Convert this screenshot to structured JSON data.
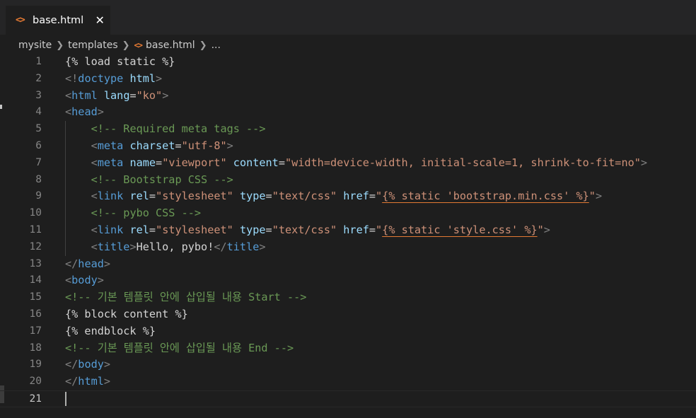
{
  "tab": {
    "icon": "html-code-icon",
    "label": "base.html",
    "close": "✕"
  },
  "breadcrumb": [
    {
      "label": "mysite"
    },
    {
      "label": "templates"
    },
    {
      "label": "base.html",
      "icon": "html-code-icon"
    },
    {
      "label": "..."
    }
  ],
  "editor": {
    "active_line": 21,
    "lines": [
      {
        "n": "1",
        "tokens": [
          [
            "{% load static %}",
            "d"
          ]
        ]
      },
      {
        "n": "2",
        "tokens": [
          [
            "<!",
            "br"
          ],
          [
            "doctype",
            "tag"
          ],
          [
            " ",
            "d"
          ],
          [
            "html",
            "attr"
          ],
          [
            ">",
            "br"
          ]
        ]
      },
      {
        "n": "3",
        "tokens": [
          [
            "<",
            "br"
          ],
          [
            "html",
            "tag"
          ],
          [
            " ",
            "d"
          ],
          [
            "lang",
            "attr"
          ],
          [
            "=",
            "d"
          ],
          [
            "\"ko\"",
            "str"
          ],
          [
            ">",
            "br"
          ]
        ]
      },
      {
        "n": "4",
        "tokens": [
          [
            "<",
            "br"
          ],
          [
            "head",
            "tag"
          ],
          [
            ">",
            "br"
          ]
        ]
      },
      {
        "n": "5",
        "tokens": [
          [
            "    ",
            "d"
          ],
          [
            "<!-- Required meta tags -->",
            "com"
          ]
        ]
      },
      {
        "n": "6",
        "tokens": [
          [
            "    ",
            "d"
          ],
          [
            "<",
            "br"
          ],
          [
            "meta",
            "tag"
          ],
          [
            " ",
            "d"
          ],
          [
            "charset",
            "attr"
          ],
          [
            "=",
            "d"
          ],
          [
            "\"utf-8\"",
            "str"
          ],
          [
            ">",
            "br"
          ]
        ]
      },
      {
        "n": "7",
        "tokens": [
          [
            "    ",
            "d"
          ],
          [
            "<",
            "br"
          ],
          [
            "meta",
            "tag"
          ],
          [
            " ",
            "d"
          ],
          [
            "name",
            "attr"
          ],
          [
            "=",
            "d"
          ],
          [
            "\"viewport\"",
            "str"
          ],
          [
            " ",
            "d"
          ],
          [
            "content",
            "attr"
          ],
          [
            "=",
            "d"
          ],
          [
            "\"width=device-width, initial-scale=1, shrink-to-fit=no\"",
            "str"
          ],
          [
            ">",
            "br"
          ]
        ]
      },
      {
        "n": "8",
        "tokens": [
          [
            "    ",
            "d"
          ],
          [
            "<!-- Bootstrap CSS -->",
            "com"
          ]
        ]
      },
      {
        "n": "9",
        "tokens": [
          [
            "    ",
            "d"
          ],
          [
            "<",
            "br"
          ],
          [
            "link",
            "tag"
          ],
          [
            " ",
            "d"
          ],
          [
            "rel",
            "attr"
          ],
          [
            "=",
            "d"
          ],
          [
            "\"stylesheet\"",
            "str"
          ],
          [
            " ",
            "d"
          ],
          [
            "type",
            "attr"
          ],
          [
            "=",
            "d"
          ],
          [
            "\"text/css\"",
            "str"
          ],
          [
            " ",
            "d"
          ],
          [
            "href",
            "attr"
          ],
          [
            "=",
            "d"
          ],
          [
            "\"",
            "str"
          ],
          [
            "{% static 'bootstrap.min.css' %}",
            "tpl"
          ],
          [
            "\"",
            "str"
          ],
          [
            ">",
            "br"
          ]
        ]
      },
      {
        "n": "10",
        "tokens": [
          [
            "    ",
            "d"
          ],
          [
            "<!-- pybo CSS -->",
            "com"
          ]
        ]
      },
      {
        "n": "11",
        "tokens": [
          [
            "    ",
            "d"
          ],
          [
            "<",
            "br"
          ],
          [
            "link",
            "tag"
          ],
          [
            " ",
            "d"
          ],
          [
            "rel",
            "attr"
          ],
          [
            "=",
            "d"
          ],
          [
            "\"stylesheet\"",
            "str"
          ],
          [
            " ",
            "d"
          ],
          [
            "type",
            "attr"
          ],
          [
            "=",
            "d"
          ],
          [
            "\"text/css\"",
            "str"
          ],
          [
            " ",
            "d"
          ],
          [
            "href",
            "attr"
          ],
          [
            "=",
            "d"
          ],
          [
            "\"",
            "str"
          ],
          [
            "{% static 'style.css' %}",
            "tpl"
          ],
          [
            "\"",
            "str"
          ],
          [
            ">",
            "br"
          ]
        ]
      },
      {
        "n": "12",
        "tokens": [
          [
            "    ",
            "d"
          ],
          [
            "<",
            "br"
          ],
          [
            "title",
            "tag"
          ],
          [
            ">",
            "br"
          ],
          [
            "Hello, pybo!",
            "d"
          ],
          [
            "</",
            "br"
          ],
          [
            "title",
            "tag"
          ],
          [
            ">",
            "br"
          ]
        ]
      },
      {
        "n": "13",
        "tokens": [
          [
            "</",
            "br"
          ],
          [
            "head",
            "tag"
          ],
          [
            ">",
            "br"
          ]
        ]
      },
      {
        "n": "14",
        "tokens": [
          [
            "<",
            "br"
          ],
          [
            "body",
            "tag"
          ],
          [
            ">",
            "br"
          ]
        ]
      },
      {
        "n": "15",
        "tokens": [
          [
            "<!-- 기본 템플릿 안에 삽입될 내용 Start -->",
            "com"
          ]
        ]
      },
      {
        "n": "16",
        "tokens": [
          [
            "{% block content %}",
            "d"
          ]
        ]
      },
      {
        "n": "17",
        "tokens": [
          [
            "{% endblock %}",
            "d"
          ]
        ]
      },
      {
        "n": "18",
        "tokens": [
          [
            "<!-- 기본 템플릿 안에 삽입될 내용 End -->",
            "com"
          ]
        ]
      },
      {
        "n": "19",
        "tokens": [
          [
            "</",
            "br"
          ],
          [
            "body",
            "tag"
          ],
          [
            ">",
            "br"
          ]
        ]
      },
      {
        "n": "20",
        "tokens": [
          [
            "</",
            "br"
          ],
          [
            "html",
            "tag"
          ],
          [
            ">",
            "br"
          ]
        ]
      },
      {
        "n": "21",
        "tokens": []
      }
    ]
  },
  "colors": {
    "background": "#1e1e1e",
    "tag": "#569cd6",
    "attribute": "#9cdcfe",
    "string": "#ce9178",
    "comment": "#6a9955",
    "html_icon": "#e37933"
  }
}
